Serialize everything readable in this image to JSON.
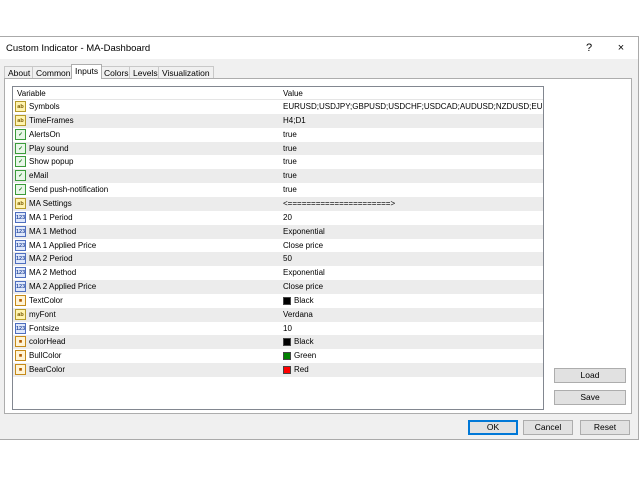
{
  "window": {
    "title": "Custom Indicator - MA-Dashboard",
    "help": "?",
    "close": "×"
  },
  "tabs": [
    {
      "label": "About"
    },
    {
      "label": "Common"
    },
    {
      "label": "Inputs",
      "active": true
    },
    {
      "label": "Colors"
    },
    {
      "label": "Levels"
    },
    {
      "label": "Visualization"
    }
  ],
  "grid": {
    "headers": {
      "variable": "Variable",
      "value": "Value"
    },
    "rows": [
      {
        "icon": "ab",
        "name": "Symbols",
        "value": "EURUSD;USDJPY;GBPUSD;USDCHF;USDCAD;AUDUSD;NZDUSD;EURJ..."
      },
      {
        "icon": "ab",
        "name": "TimeFrames",
        "value": "H4;D1"
      },
      {
        "icon": "bool",
        "name": "AlertsOn",
        "value": "true"
      },
      {
        "icon": "bool",
        "name": "Play sound",
        "value": "true"
      },
      {
        "icon": "bool",
        "name": "Show popup",
        "value": "true"
      },
      {
        "icon": "bool",
        "name": "eMail",
        "value": "true"
      },
      {
        "icon": "bool",
        "name": "Send push-notification",
        "value": "true"
      },
      {
        "icon": "ab",
        "name": "MA Settings",
        "value": "<======================>"
      },
      {
        "icon": "num",
        "name": "MA 1 Period",
        "value": "20"
      },
      {
        "icon": "num",
        "name": "MA 1 Method",
        "value": "Exponential"
      },
      {
        "icon": "num",
        "name": "MA 1 Applied Price",
        "value": "Close price"
      },
      {
        "icon": "num",
        "name": "MA 2 Period",
        "value": "50"
      },
      {
        "icon": "num",
        "name": "MA 2 Method",
        "value": "Exponential"
      },
      {
        "icon": "num",
        "name": "MA 2 Applied Price",
        "value": "Close price"
      },
      {
        "icon": "color",
        "name": "TextColor",
        "value": "Black",
        "swatch": "#000000"
      },
      {
        "icon": "ab",
        "name": "myFont",
        "value": "Verdana"
      },
      {
        "icon": "num",
        "name": "Fontsize",
        "value": "10"
      },
      {
        "icon": "color",
        "name": "colorHead",
        "value": "Black",
        "swatch": "#000000"
      },
      {
        "icon": "color",
        "name": "BullColor",
        "value": "Green",
        "swatch": "#008000"
      },
      {
        "icon": "color",
        "name": "BearColor",
        "value": "Red",
        "swatch": "#ff0000"
      }
    ]
  },
  "side_buttons": {
    "load": "Load",
    "save": "Save"
  },
  "footer_buttons": {
    "ok": "OK",
    "cancel": "Cancel",
    "reset": "Reset"
  },
  "icon_labels": {
    "ab": "ab",
    "bool": "✓",
    "num": "123",
    "color": "■"
  }
}
